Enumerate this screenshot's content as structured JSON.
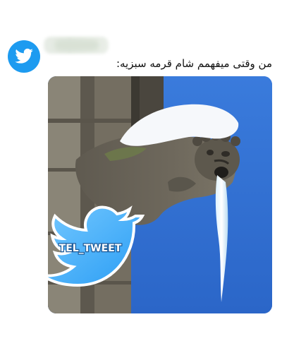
{
  "tweet": {
    "text": "من وقتی میفهمم شام قرمه سبزیه:"
  },
  "avatar": {
    "icon": "twitter-bird-icon",
    "color": "#1d9bf0"
  },
  "media": {
    "watermark_text": "TEL_TWEET",
    "watermark_icon": "twitter-bird-icon"
  },
  "colors": {
    "sky": "#2f6fd3",
    "brand": "#1d9bf0"
  }
}
